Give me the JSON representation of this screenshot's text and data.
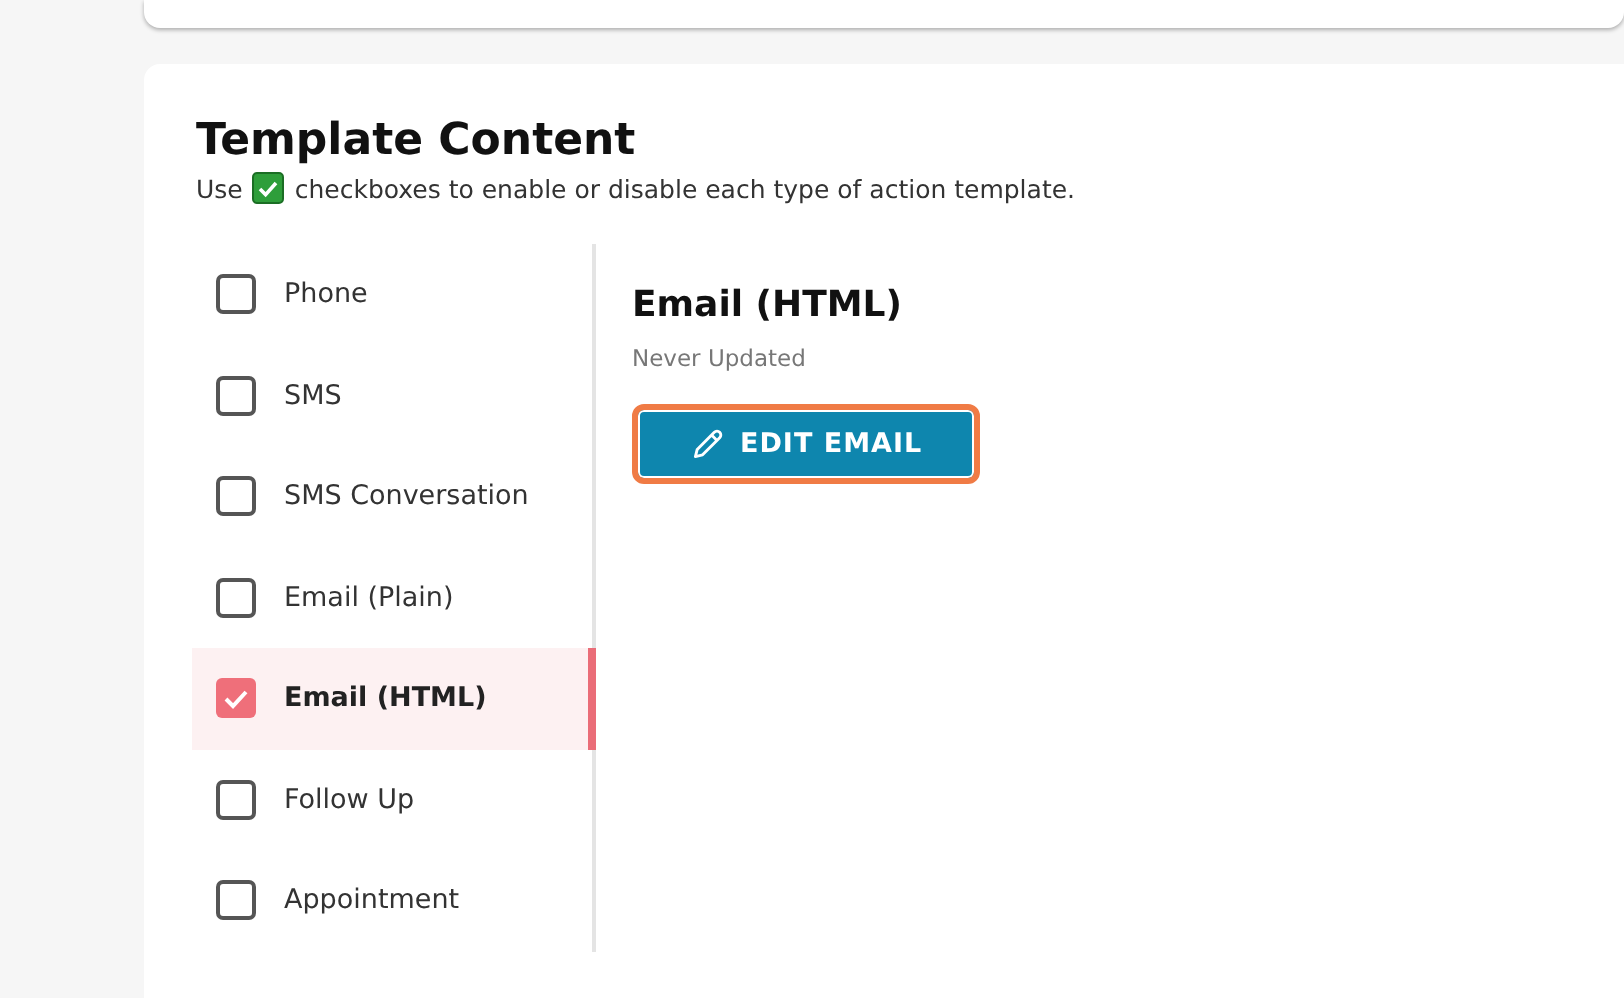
{
  "section": {
    "title": "Template Content",
    "hint_before": "Use",
    "hint_after": "checkboxes to enable or disable each type of action template."
  },
  "templates": [
    {
      "label": "Phone",
      "checked": false,
      "selected": false
    },
    {
      "label": "SMS",
      "checked": false,
      "selected": false
    },
    {
      "label": "SMS Conversation",
      "checked": false,
      "selected": false
    },
    {
      "label": "Email (Plain)",
      "checked": false,
      "selected": false
    },
    {
      "label": "Email (HTML)",
      "checked": true,
      "selected": true
    },
    {
      "label": "Follow Up",
      "checked": false,
      "selected": false
    },
    {
      "label": "Appointment",
      "checked": false,
      "selected": false
    }
  ],
  "detail": {
    "title": "Email (HTML)",
    "updated": "Never Updated",
    "button": "EDIT EMAIL"
  }
}
